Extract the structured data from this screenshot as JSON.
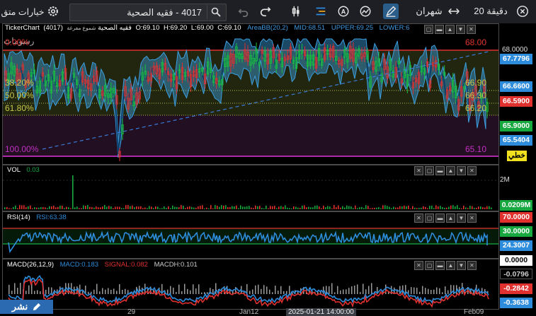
{
  "toolbar": {
    "options_label": "خيارات متق",
    "symbol_text": "4017 - فقيه الصحية",
    "period_label": "شهران",
    "interval_label": "20 دقيقة"
  },
  "main": {
    "header": {
      "brand": "TickerChart",
      "name": "(4017) فقيه الصحية",
      "sub": "شموع مفرغة",
      "open": "O:69.10",
      "high": "H:69.20",
      "low": "L:69.00",
      "close": "C:69.10",
      "bb": "AreaBB(20,2)",
      "mid": "MID:68.51",
      "upper": "UPPER:69.25",
      "lower": "LOWER:6",
      "drawings": "رسومات"
    },
    "fib_left": [
      "0.00%",
      "38.20%",
      "50.00%",
      "61.80%",
      "100.00%"
    ],
    "fib_right": [
      "68.00",
      "66.90",
      "66.30",
      "66.20",
      "65.10"
    ],
    "axis_top": "68.0000",
    "tags": [
      "67.7796",
      "66.6600",
      "66.5900",
      "65.9000",
      "65.5404",
      "خطي"
    ]
  },
  "volume": {
    "title": "VOL",
    "value": "0.03",
    "axis": "2M",
    "tag": "0.0209M"
  },
  "rsi": {
    "title": "RSI(14)",
    "value": "RSI:63.38",
    "tags": [
      "70.0000",
      "30.0000",
      "24.3007"
    ]
  },
  "macd": {
    "title": "MACD(26,12,9)",
    "macd": "MACD:0.183",
    "signal": "SIGNAL:0.082",
    "hist": "MACDH:0.101",
    "tags": [
      "0.0000",
      "-0.0796",
      "-0.2842",
      "-0.3638"
    ]
  },
  "timeaxis": {
    "labels": [
      "29",
      "Jan12",
      "2025-01-21 14:00:00",
      "Feb09"
    ]
  },
  "share_label": "نشر",
  "colors": {
    "accent": "#2b6ab0",
    "red": "#e0312f",
    "green": "#18a840",
    "blue": "#2d8cdb",
    "fib_yellow": "#c8c84a"
  }
}
